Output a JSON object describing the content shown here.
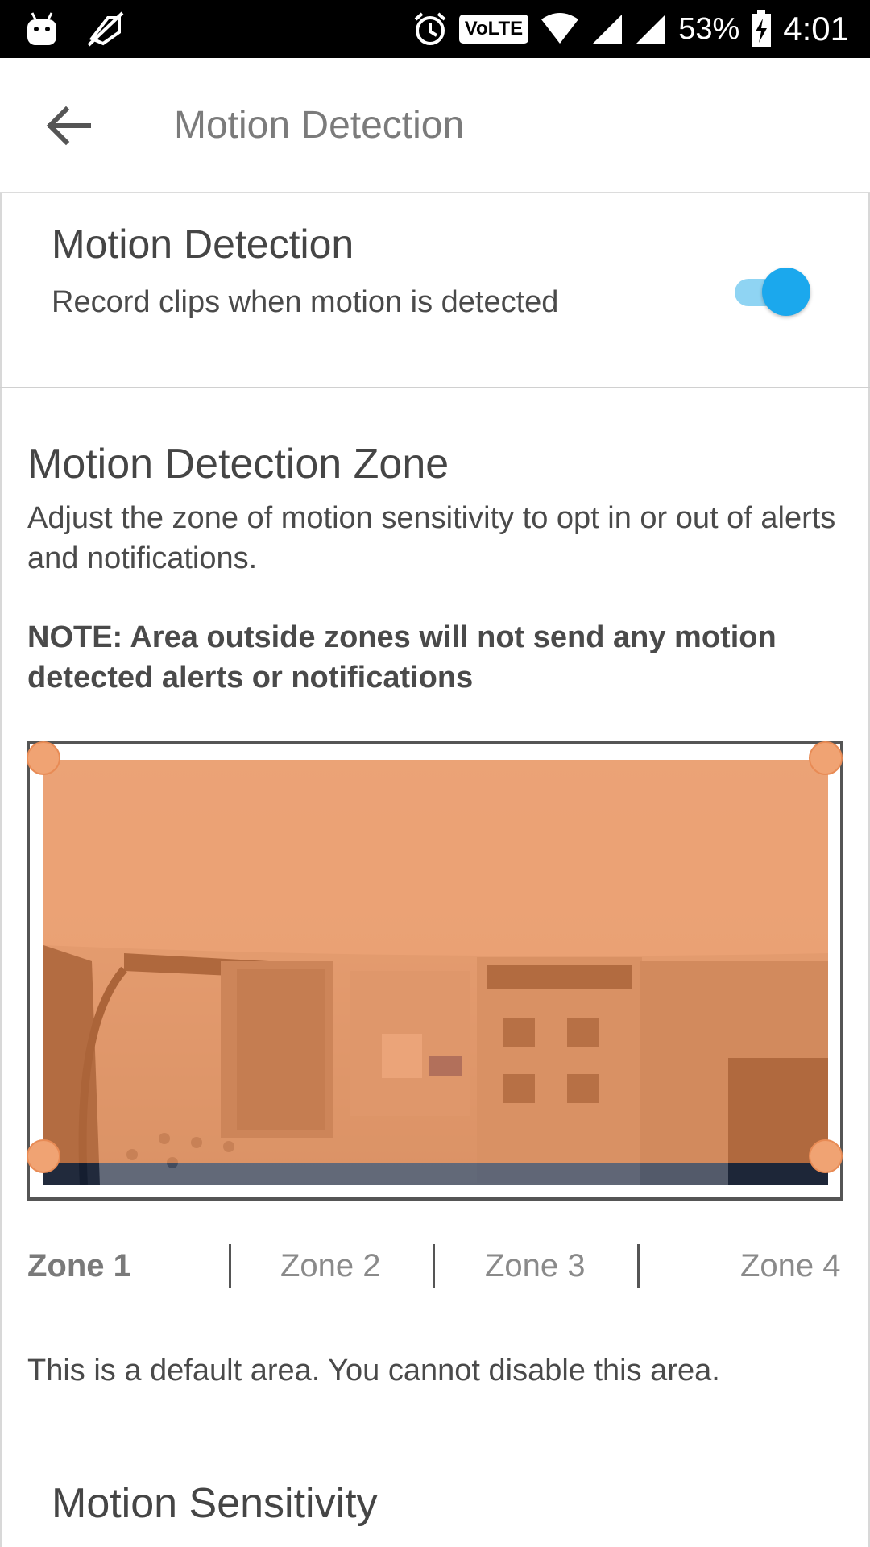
{
  "status_bar": {
    "battery": "53%",
    "time": "4:01",
    "volte": "VoLTE",
    "icons": [
      "android-icon",
      "no-sim-icon",
      "alarm-icon",
      "volte-icon",
      "wifi-icon",
      "signal-icon",
      "signal-icon",
      "battery-charging-icon"
    ]
  },
  "app_bar": {
    "title": "Motion Detection",
    "back_icon": "back-arrow-icon"
  },
  "motion_detection": {
    "title": "Motion Detection",
    "subtitle": "Record clips when motion is detected",
    "enabled": true
  },
  "zone_section": {
    "title": "Motion Detection Zone",
    "description": "Adjust the zone of motion sensitivity to opt in or out of alerts and notifications.",
    "note": "NOTE: Area outside zones will not send any motion detected alerts or notifications"
  },
  "zone_tabs": [
    {
      "label": "Zone 1",
      "active": true
    },
    {
      "label": "Zone 2",
      "active": false
    },
    {
      "label": "Zone 3",
      "active": false
    },
    {
      "label": "Zone 4",
      "active": false
    }
  ],
  "default_area_text": "This is a default area. You cannot disable this area.",
  "sensitivity_title": "Motion Sensitivity",
  "colors": {
    "accent": "#1ba8ed",
    "zone_overlay": "#e8854a",
    "handle": "#f0a373"
  }
}
